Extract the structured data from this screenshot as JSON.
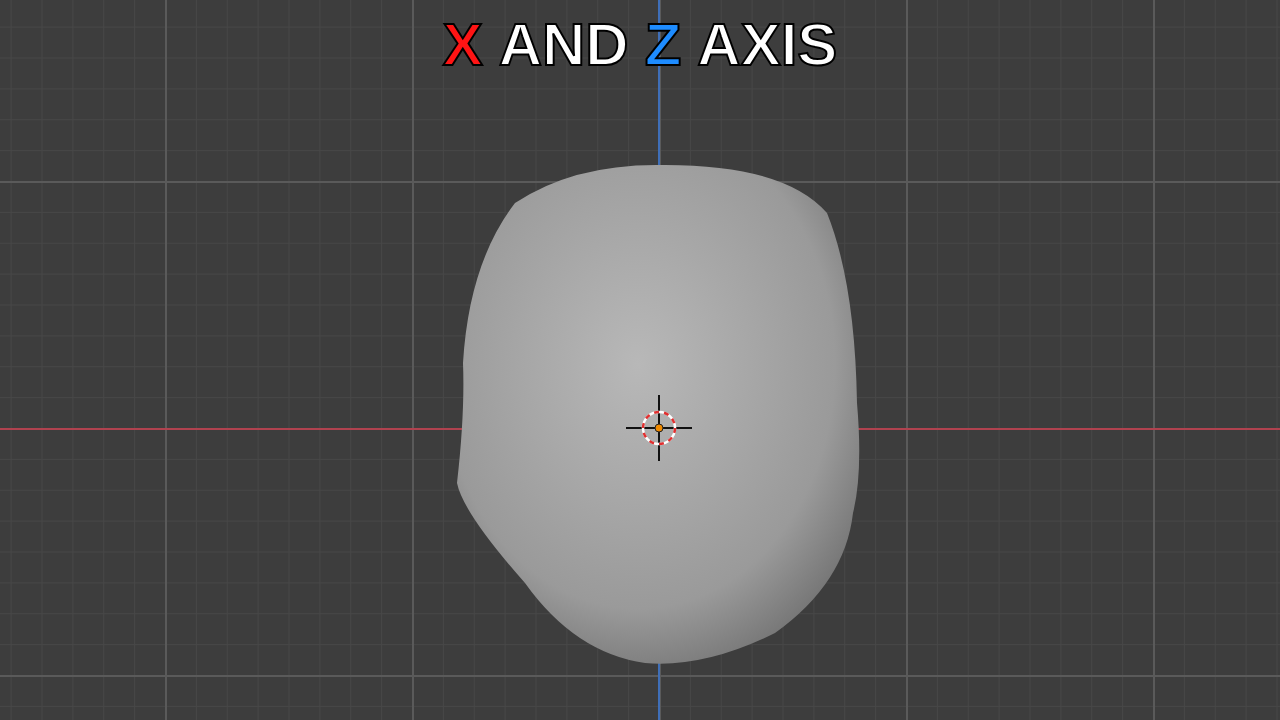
{
  "title": {
    "words": [
      {
        "text": "X",
        "color": "#ff1414"
      },
      {
        "text": "AND",
        "color": "#ffffff"
      },
      {
        "text": "Z",
        "color": "#1e8cff"
      },
      {
        "text": "AXIS",
        "color": "#ffffff"
      }
    ]
  }
}
